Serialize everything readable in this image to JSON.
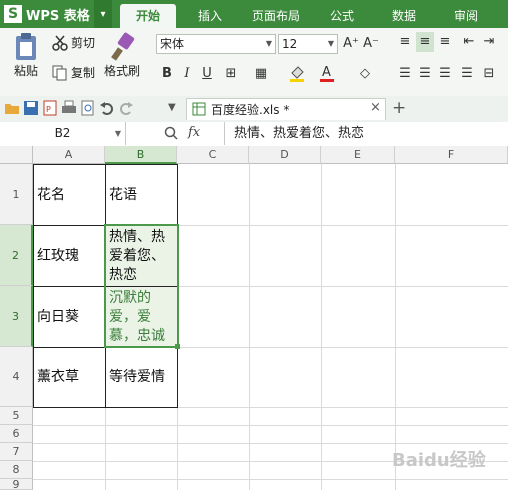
{
  "app": {
    "logo": "S",
    "name": "WPS 表格",
    "dropdown": "▾"
  },
  "ribbon_tabs": [
    "开始",
    "插入",
    "页面布局",
    "公式",
    "数据",
    "审阅"
  ],
  "ribbon": {
    "paste": "粘贴",
    "cut": "剪切",
    "copy": "复制",
    "format_painter": "格式刷",
    "font_name": "宋体",
    "font_size": "12",
    "bold": "B",
    "italic": "I",
    "underline": "U"
  },
  "document": {
    "tab_title": "百度经验.xls *",
    "close": "×",
    "new_tab": "+"
  },
  "formula_bar": {
    "cell_ref": "B2",
    "fx": "fx",
    "value": "热情、热爱着您、热恋"
  },
  "columns": [
    "A",
    "B",
    "C",
    "D",
    "E",
    "F"
  ],
  "rows": [
    "1",
    "2",
    "3",
    "4",
    "5",
    "6",
    "7",
    "8",
    "9"
  ],
  "cells": {
    "A1": "花名",
    "B1": "花语",
    "A2": "红玫瑰",
    "B2": "热情、热爱着您、热恋",
    "A3": "向日葵",
    "B3": "沉默的爱，爱慕，忠诚",
    "A4": "薰衣草",
    "B4": "等待爱情"
  },
  "watermark": "Baidu经验",
  "colors": {
    "brand_green": "#3c8a3c",
    "selection_green": "#4b9a4b",
    "b3_text": "#3a7d3a"
  }
}
